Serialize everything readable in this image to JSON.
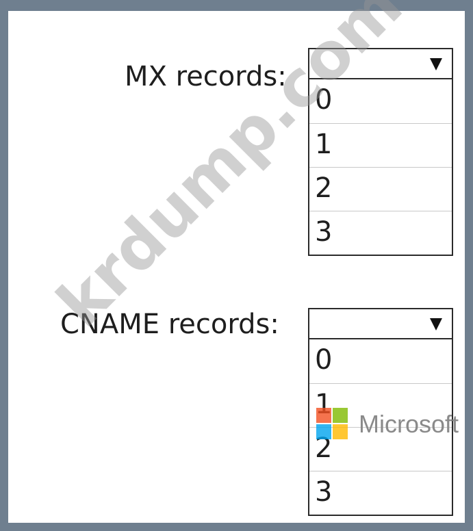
{
  "mx": {
    "label": "MX records:",
    "selected": "",
    "options": [
      "0",
      "1",
      "2",
      "3"
    ]
  },
  "cname": {
    "label": "CNAME records:",
    "selected": "",
    "options": [
      "0",
      "1",
      "2",
      "3"
    ]
  },
  "overlays": {
    "watermark": "krdump.com",
    "brand": "Microsoft"
  }
}
